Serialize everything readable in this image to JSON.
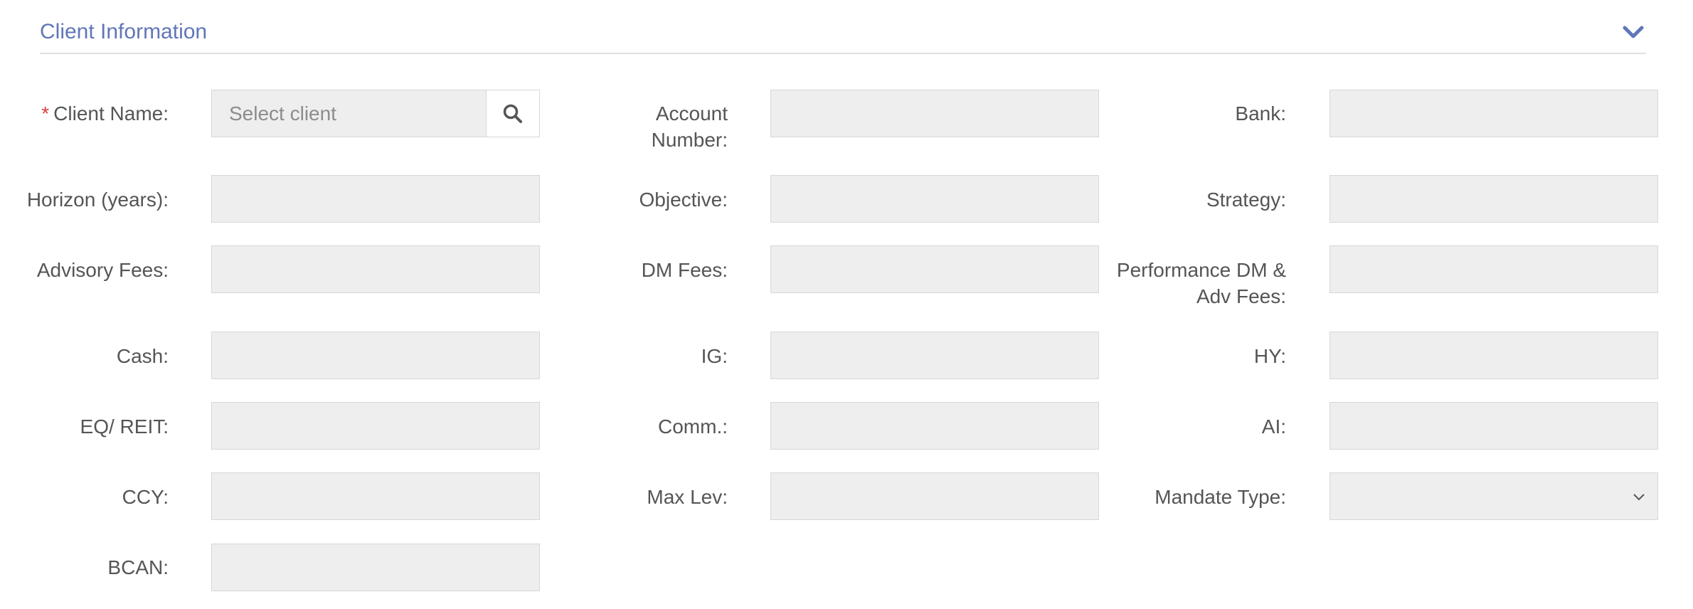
{
  "section": {
    "title": "Client Information",
    "toggle_icon": "chevron-down-icon",
    "accent_color": "#6076b8"
  },
  "client_name": {
    "required_marker": "*",
    "label": "Client Name:",
    "placeholder": "Select client",
    "value": "",
    "search_icon": "search-icon"
  },
  "fields": {
    "account_number": {
      "label": "Account Number:",
      "value": ""
    },
    "bank": {
      "label": "Bank:",
      "value": ""
    },
    "horizon": {
      "label": "Horizon (years):",
      "value": ""
    },
    "objective": {
      "label": "Objective:",
      "value": ""
    },
    "strategy": {
      "label": "Strategy:",
      "value": ""
    },
    "advisory_fees": {
      "label": "Advisory Fees:",
      "value": ""
    },
    "dm_fees": {
      "label": "DM Fees:",
      "value": ""
    },
    "performance_fees": {
      "label": "Performance DM & Adv Fees:",
      "value": ""
    },
    "cash": {
      "label": "Cash:",
      "value": ""
    },
    "ig": {
      "label": "IG:",
      "value": ""
    },
    "hy": {
      "label": "HY:",
      "value": ""
    },
    "eq_reit": {
      "label": "EQ/ REIT:",
      "value": ""
    },
    "comm": {
      "label": "Comm.:",
      "value": ""
    },
    "ai": {
      "label": "AI:",
      "value": ""
    },
    "ccy": {
      "label": "CCY:",
      "value": ""
    },
    "max_lev": {
      "label": "Max Lev:",
      "value": ""
    },
    "mandate_type": {
      "label": "Mandate Type:",
      "value": "",
      "dropdown_icon": "chevron-down-icon"
    },
    "bcan": {
      "label": "BCAN:",
      "value": ""
    }
  }
}
